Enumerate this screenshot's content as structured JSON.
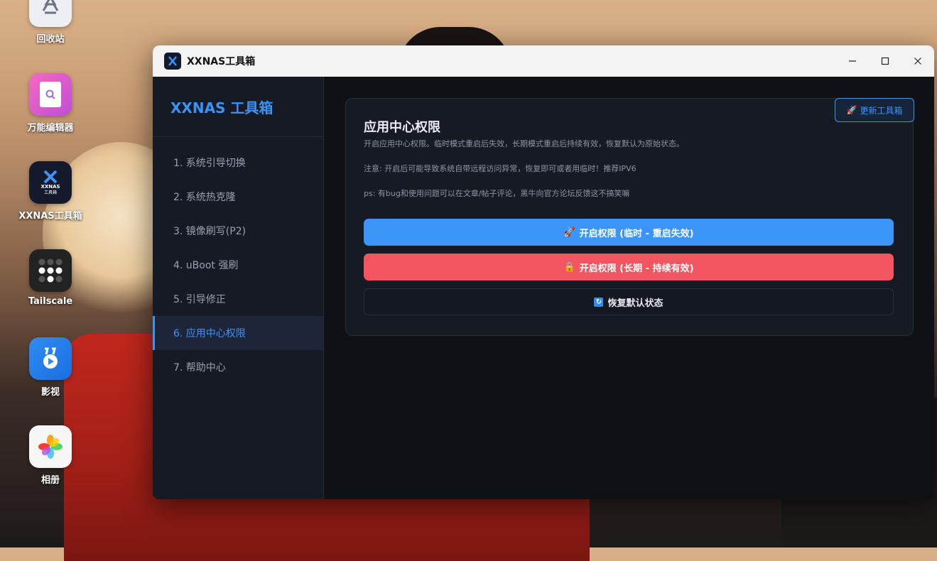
{
  "desktop": {
    "icons": [
      {
        "label": "回收站",
        "icon": "recycle-bin-icon"
      },
      {
        "label": "万能编辑器",
        "icon": "editor-icon"
      },
      {
        "label": "XXNAS工具箱",
        "icon": "xxnas-app-icon",
        "tile_text": "XXNAS",
        "tile_sub": "工具箱"
      },
      {
        "label": "Tailscale",
        "icon": "tailscale-icon"
      },
      {
        "label": "影视",
        "icon": "video-icon"
      },
      {
        "label": "相册",
        "icon": "photos-icon"
      }
    ]
  },
  "window": {
    "title": "XXNAS工具箱",
    "controls": [
      "minimize",
      "maximize",
      "close"
    ]
  },
  "sidebar": {
    "brand": "XXNAS 工具箱",
    "items": [
      {
        "label": "1. 系统引导切换",
        "active": false
      },
      {
        "label": "2. 系统热克隆",
        "active": false
      },
      {
        "label": "3. 镜像刷写(P2)",
        "active": false
      },
      {
        "label": "4. uBoot 强刷",
        "active": false
      },
      {
        "label": "5. 引导修正",
        "active": false
      },
      {
        "label": "6. 应用中心权限",
        "active": true
      },
      {
        "label": "7. 帮助中心",
        "active": false
      }
    ]
  },
  "main": {
    "update_button": "更新工具箱",
    "title": "应用中心权限",
    "description": "开启应用中心权限。临时模式重启后失效，长期模式重启后持续有效，恢复默认为原始状态。",
    "note": "注意: 开启后可能导致系统自带远程访问异常，恢复即可或者用临时！推荐IPV6",
    "ps": "ps: 有bug和使用问题可以在文章/帖子评论，黑牛向官方论坛反馈这不搞笑嘛",
    "buttons": {
      "temp": "开启权限 (临时 - 重启失效)",
      "long": "开启权限 (长期 - 持续有效)",
      "restore": "恢复默认状态"
    }
  },
  "colors": {
    "accent": "#3d93f5",
    "danger": "#f25560",
    "primary_button": "#3b95f7"
  }
}
